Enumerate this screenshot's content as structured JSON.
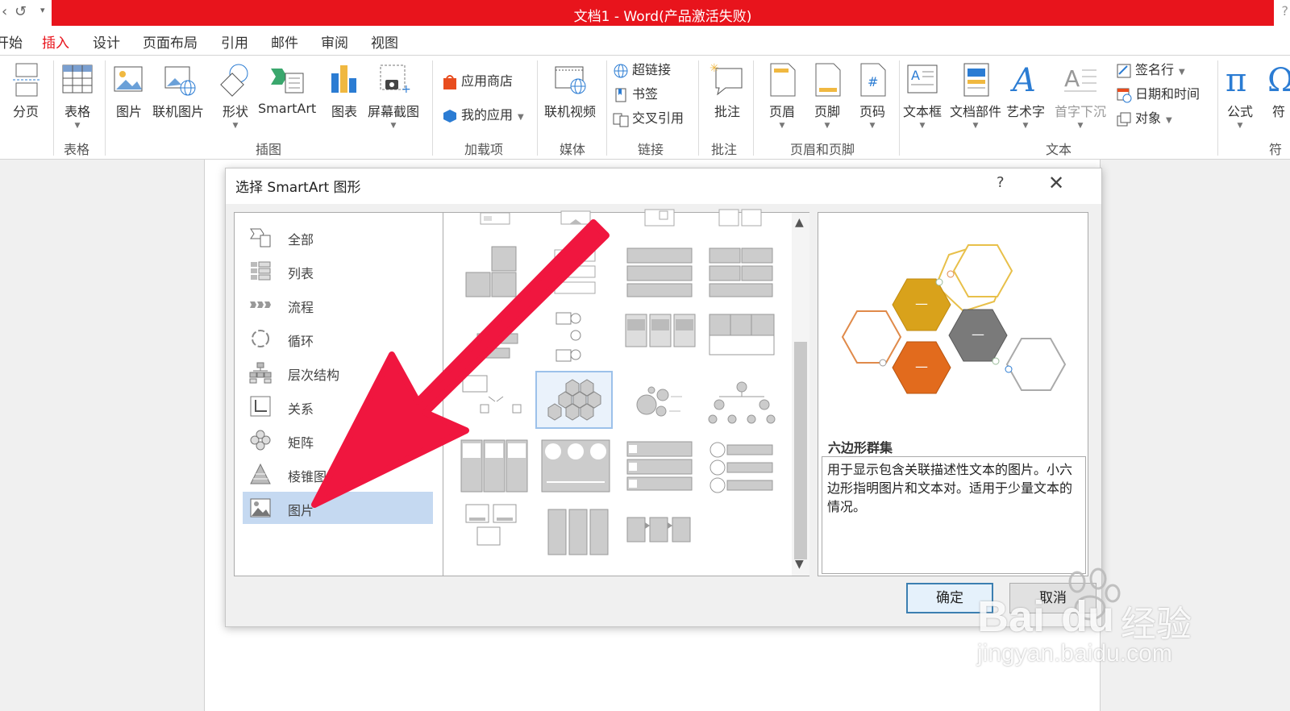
{
  "window": {
    "title": "文档1 -  Word(产品激活失败)",
    "help": "?"
  },
  "tabs": {
    "items": [
      "开始",
      "插入",
      "设计",
      "页面布局",
      "引用",
      "邮件",
      "审阅",
      "视图"
    ],
    "active": "插入"
  },
  "ribbon": {
    "page_break": "分页",
    "table": "表格",
    "picture": "图片",
    "online_picture": "联机图片",
    "shapes": "形状",
    "smartart": "SmartArt",
    "chart": "图表",
    "screenshot": "屏幕截图",
    "app_store": "应用商店",
    "my_apps": "我的应用",
    "online_video": "联机视频",
    "hyperlink": "超链接",
    "bookmark": "书签",
    "cross_ref": "交叉引用",
    "comment": "批注",
    "header": "页眉",
    "footer": "页脚",
    "page_number": "页码",
    "text_box": "文本框",
    "quick_parts": "文档部件",
    "wordart": "艺术字",
    "drop_cap": "首字下沉",
    "signature": "签名行",
    "date_time": "日期和时间",
    "object": "对象",
    "equation": "公式",
    "symbol": "符",
    "groups": {
      "tables": "表格",
      "illustrations": "插图",
      "addins": "加载项",
      "media": "媒体",
      "links": "链接",
      "comments": "批注",
      "header_footer": "页眉和页脚",
      "text": "文本",
      "symbols": "符"
    }
  },
  "dialog": {
    "title": "选择 SmartArt 图形",
    "help": "?",
    "close": "✕",
    "categories": [
      "全部",
      "列表",
      "流程",
      "循环",
      "层次结构",
      "关系",
      "矩阵",
      "棱锥图",
      "图片"
    ],
    "selected_category": "图片",
    "preview_name": "六边形群集",
    "preview_desc": "用于显示包含关联描述性文本的图片。小六边形指明图片和文本对。适用于少量文本的情况。",
    "ok": "确定",
    "cancel": "取消",
    "hex_label": "—"
  },
  "watermark": {
    "brand": "Bai",
    "brand_du": "du",
    "cn": "经验",
    "url": "jingyan.baidu.com"
  },
  "colors": {
    "title_red": "#e8141c",
    "selection": "#c5d9f1",
    "arrow": "#f0163f",
    "hex_gold": "#d9a21b",
    "hex_orange": "#e26b1d",
    "hex_gray": "#7a7a7a"
  }
}
